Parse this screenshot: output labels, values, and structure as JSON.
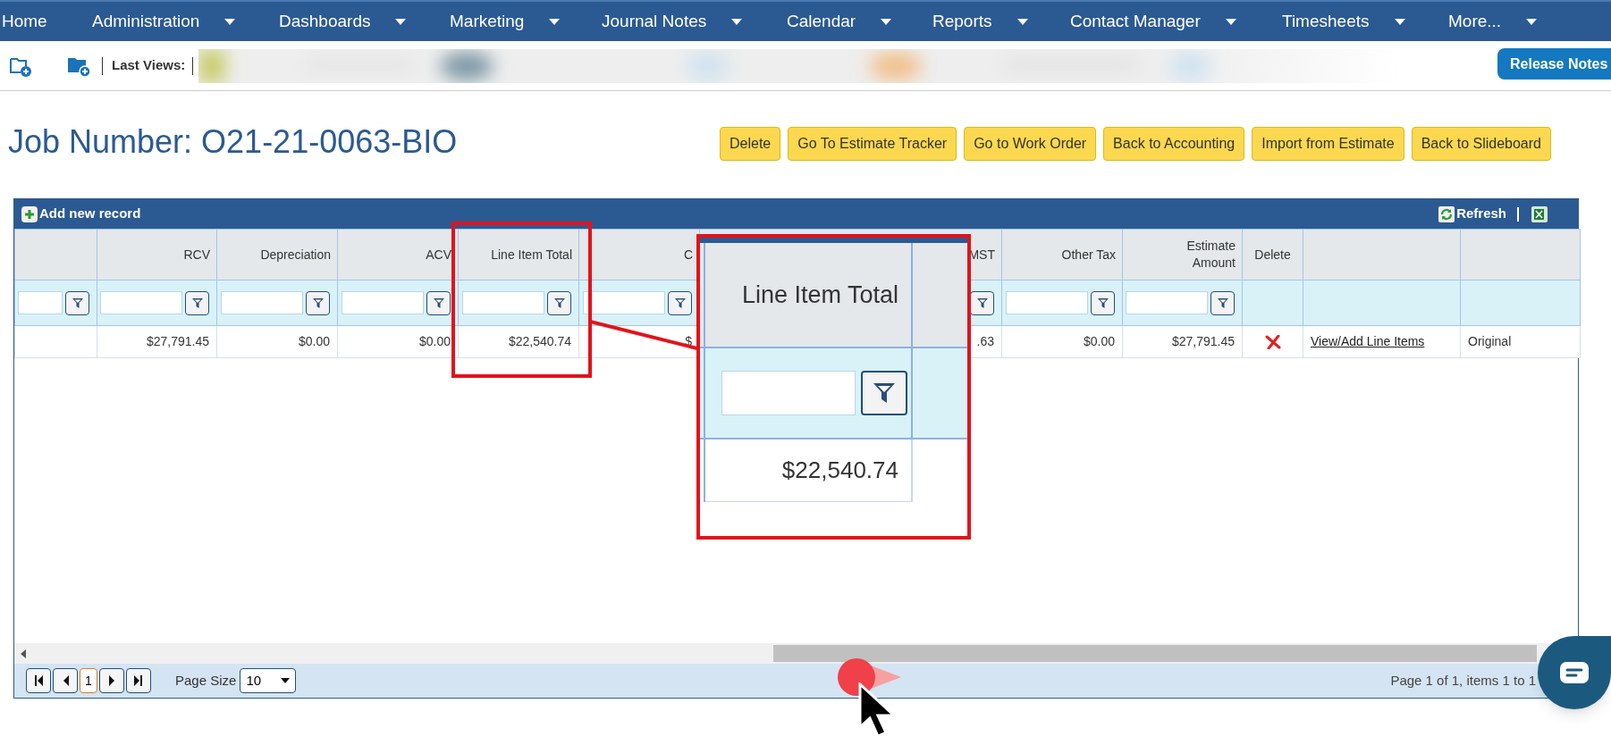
{
  "nav": {
    "items": [
      {
        "label": "Home",
        "dropdown": false
      },
      {
        "label": "Administration",
        "dropdown": true
      },
      {
        "label": "Dashboards",
        "dropdown": true
      },
      {
        "label": "Marketing",
        "dropdown": true
      },
      {
        "label": "Journal Notes",
        "dropdown": true
      },
      {
        "label": "Calendar",
        "dropdown": true
      },
      {
        "label": "Reports",
        "dropdown": true
      },
      {
        "label": "Contact Manager",
        "dropdown": true
      },
      {
        "label": "Timesheets",
        "dropdown": true
      },
      {
        "label": "More...",
        "dropdown": true
      }
    ]
  },
  "toolbar": {
    "last_views_label": "Last Views:",
    "release_notes": "Release Notes"
  },
  "title": "Job Number: O21-21-0063-BIO",
  "actions": [
    "Delete",
    "Go To Estimate Tracker",
    "Go to Work Order",
    "Back to Accounting",
    "Import from Estimate",
    "Back to Slideboard"
  ],
  "grid": {
    "add_record": "Add new record",
    "refresh": "Refresh",
    "columns": [
      {
        "filter": true
      },
      {
        "header": "RCV",
        "filter": true
      },
      {
        "header": "Depreciation",
        "filter": true
      },
      {
        "header": "ACV",
        "filter": true
      },
      {
        "header": "Line Item Total",
        "filter": true
      },
      {
        "header": "C",
        "filter": true
      },
      {
        "header": "MST",
        "filter": true
      },
      {
        "header": "Other Tax",
        "filter": true
      },
      {
        "header": "Estimate Amount",
        "filter": true
      },
      {
        "header": "Delete",
        "filter": false
      },
      {
        "filter": false
      },
      {
        "filter": false
      }
    ],
    "rows": [
      {
        "cells": [
          {
            "kind": "text"
          },
          {
            "kind": "text",
            "text": "$27,791.45"
          },
          {
            "kind": "text",
            "text": "$0.00"
          },
          {
            "kind": "text",
            "text": "$0.00"
          },
          {
            "kind": "text",
            "text": "$22,540.74"
          },
          {
            "kind": "text",
            "text": "$"
          },
          {
            "kind": "text",
            "text": ".63"
          },
          {
            "kind": "text",
            "text": "$0.00"
          },
          {
            "kind": "text",
            "text": "$27,791.45"
          },
          {
            "kind": "delete"
          },
          {
            "kind": "link",
            "text": "View/Add Line Items"
          },
          {
            "kind": "label",
            "text": "Original"
          }
        ]
      }
    ],
    "pager": {
      "page": "1",
      "page_size_label": "Page Size",
      "page_size": "10",
      "info": "Page 1 of 1, items 1 to 1"
    }
  },
  "magnifier": {
    "header": "Line Item Total",
    "value": "$22,540.74"
  }
}
